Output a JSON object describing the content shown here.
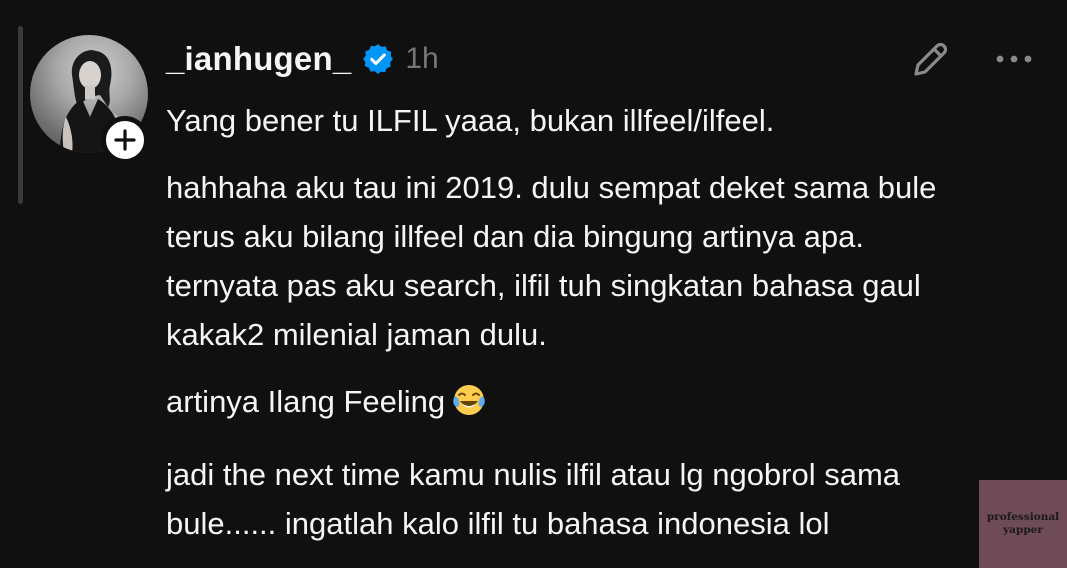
{
  "post": {
    "author": {
      "username": "_ianhugen_",
      "verified": true,
      "avatar_icon": "profile-photo",
      "follow_icon": "plus-icon"
    },
    "timestamp": "1h",
    "actions": {
      "edit_icon": "pencil-icon",
      "more_icon": "more-dots-icon"
    },
    "paragraphs": [
      "Yang bener tu ILFIL yaaa, bukan illfeel/ilfeel.",
      "hahhaha aku tau ini 2019. dulu sempat deket sama bule\nterus aku bilang illfeel dan dia bingung artinya apa.\nternyata pas aku search, ilfil tuh singkatan bahasa gaul\nkakak2 milenial jaman dulu.",
      "artinya Ilang Feeling",
      "jadi the next time kamu nulis ilfil atau lg ngobrol sama\nbule...... ingatlah kalo ilfil tu bahasa indonesia lol"
    ],
    "emoji": "face-with-tears-of-joy"
  },
  "watermark": {
    "line1": "professional",
    "line2": "yapper"
  },
  "colors": {
    "background": "#101010",
    "text": "#f3f5f7",
    "muted": "#777777",
    "verified": "#0095f6",
    "watermark_bg": "#6f4a57"
  }
}
